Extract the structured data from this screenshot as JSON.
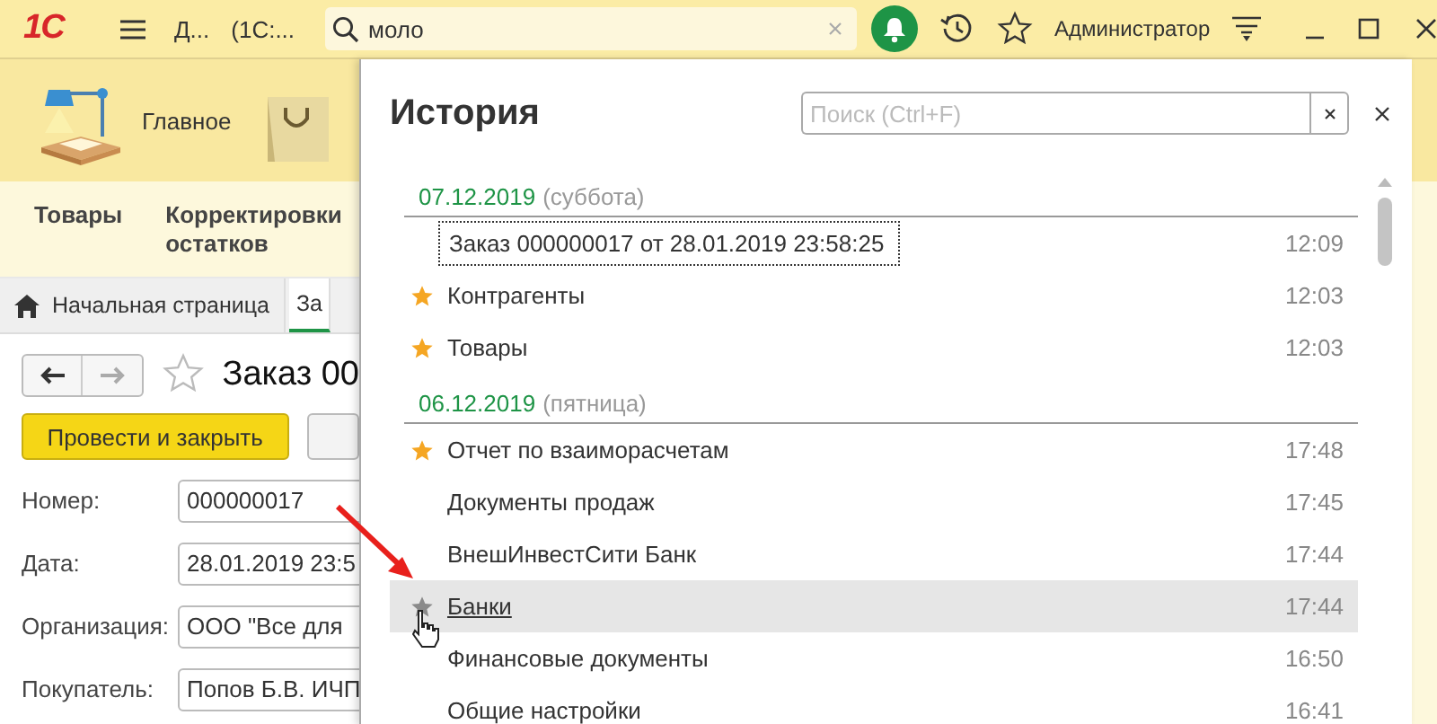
{
  "top_bar": {
    "logo": "1С",
    "app_title": "Д...",
    "config_title": "(1С:...",
    "search": {
      "value": "моло"
    },
    "user": "Администратор"
  },
  "sections": [
    {
      "label": "Главное"
    }
  ],
  "section_commands": [
    "Товары",
    "Корректировки остатков"
  ],
  "tabs": [
    {
      "label": "Начальная страница",
      "selected": false,
      "home": true
    },
    {
      "label": "За",
      "selected": true,
      "home": false
    }
  ],
  "form": {
    "title": "Заказ 00",
    "favorite": false,
    "post_button": "Провести и закрыть",
    "fields": [
      {
        "label": "Номер:",
        "value": "000000017"
      },
      {
        "label": "Дата:",
        "value": "28.01.2019 23:5"
      },
      {
        "label": "Организация:",
        "value": "ООО \"Все для"
      },
      {
        "label": "Покупатель:",
        "value": "Попов Б.В. ИЧП"
      }
    ]
  },
  "history": {
    "title": "История",
    "search": {
      "placeholder": "Поиск (Ctrl+F)"
    },
    "items": [
      {
        "kind": "date",
        "date": "07.12.2019",
        "weekday": "(суббота)"
      },
      {
        "kind": "entry",
        "text": "Заказ 000000017 от 28.01.2019 23:58:25",
        "time": "12:09",
        "favorite": false,
        "focused": true,
        "hovered": false
      },
      {
        "kind": "entry",
        "text": "Контрагенты",
        "time": "12:03",
        "favorite": true,
        "focused": false,
        "hovered": false
      },
      {
        "kind": "entry",
        "text": "Товары",
        "time": "12:03",
        "favorite": true,
        "focused": false,
        "hovered": false
      },
      {
        "kind": "date",
        "date": "06.12.2019",
        "weekday": "(пятница)"
      },
      {
        "kind": "entry",
        "text": "Отчет по взаиморасчетам",
        "time": "17:48",
        "favorite": true,
        "focused": false,
        "hovered": false
      },
      {
        "kind": "entry",
        "text": "Документы продаж",
        "time": "17:45",
        "favorite": false,
        "focused": false,
        "hovered": false
      },
      {
        "kind": "entry",
        "text": "ВнешИнвестСити Банк",
        "time": "17:44",
        "favorite": false,
        "focused": false,
        "hovered": false
      },
      {
        "kind": "entry",
        "text": "Банки",
        "time": "17:44",
        "favorite": false,
        "focused": false,
        "hovered": true
      },
      {
        "kind": "entry",
        "text": "Финансовые документы",
        "time": "16:50",
        "favorite": false,
        "focused": false,
        "hovered": false
      },
      {
        "kind": "entry",
        "text": "Общие настройки",
        "time": "16:41",
        "favorite": false,
        "focused": false,
        "hovered": false
      }
    ]
  }
}
